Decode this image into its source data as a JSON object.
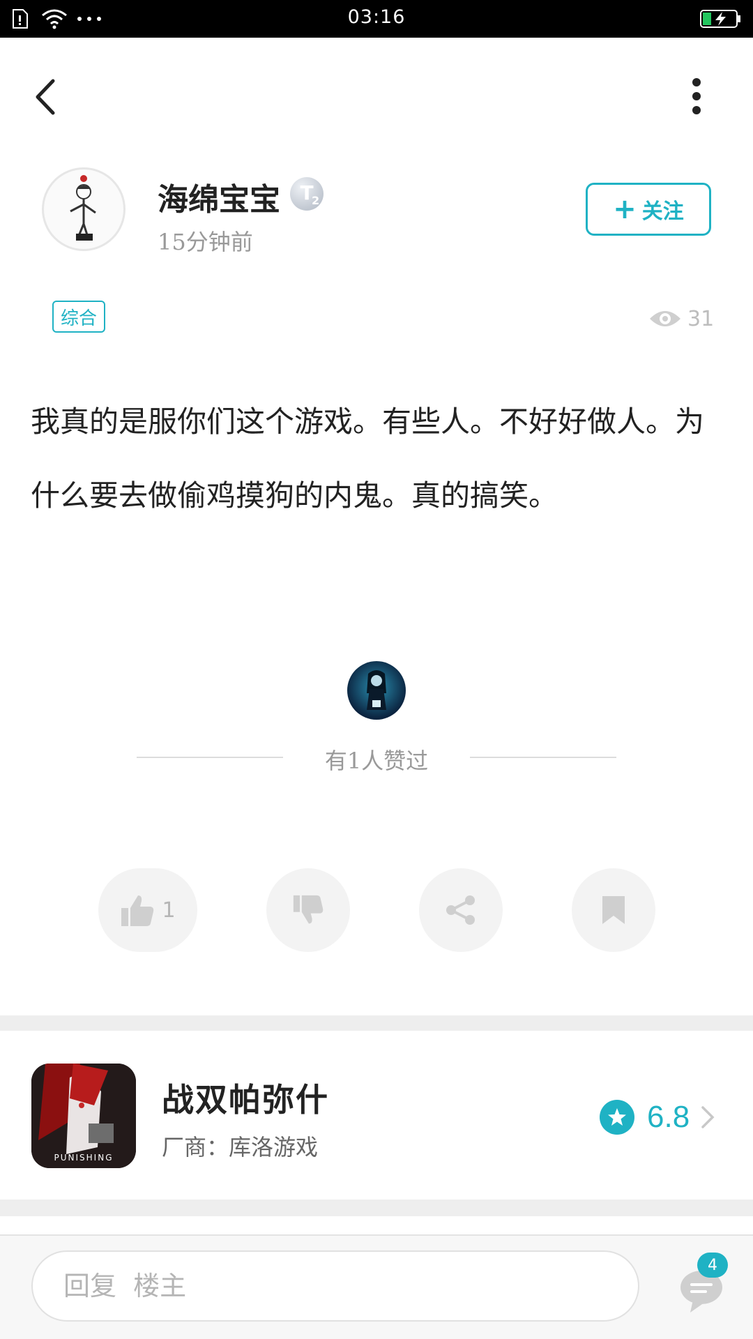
{
  "status_bar": {
    "time": "03:16"
  },
  "post": {
    "author": {
      "name": "海绵宝宝",
      "badge": "T",
      "badge_level": "2"
    },
    "time_ago": "15分钟前",
    "follow_label": "关注",
    "category": "综合",
    "views": "31",
    "content": "我真的是服你们这个游戏。有些人。不好好做人。为什么要去做偷鸡摸狗的内鬼。真的搞笑。",
    "likes_summary": "有1人赞过",
    "actions": {
      "like_count": "1"
    }
  },
  "game": {
    "name": "战双帕弥什",
    "vendor": "厂商：库洛游戏",
    "rating": "6.8",
    "icon_text": "PUNISHING"
  },
  "reply_bar": {
    "placeholder": "回复  楼主",
    "comment_count": "4"
  },
  "colors": {
    "accent": "#1fb2c4",
    "text": "#222222",
    "muted": "#999999"
  }
}
